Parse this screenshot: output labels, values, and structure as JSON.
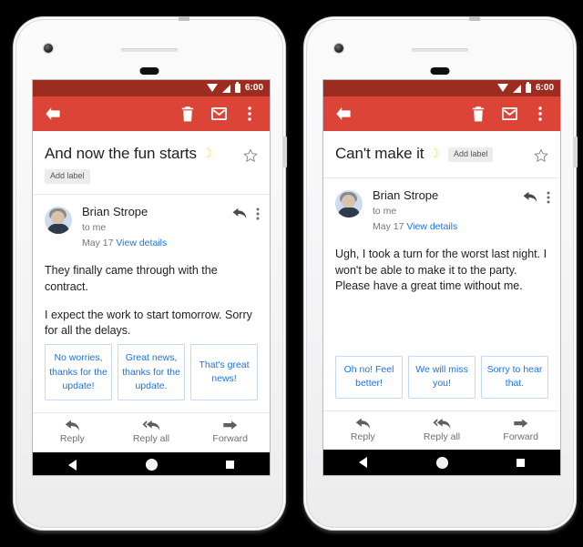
{
  "background_color": "#000000",
  "colors": {
    "status_bar": "#9c2b20",
    "app_bar": "#db4437",
    "link_blue": "#1a73e8",
    "chip_border": "#c3d9f5",
    "text_primary": "#212121",
    "text_secondary": "#757575"
  },
  "status_bar": {
    "time": "6:00",
    "icons": [
      "wifi-icon",
      "signal-icon",
      "battery-icon"
    ]
  },
  "app_bar": {
    "back_icon": "back-arrow-icon",
    "delete_icon": "trash-icon",
    "mark_unread_icon": "envelope-icon",
    "overflow_icon": "overflow-menu-icon"
  },
  "sender": {
    "name": "Brian Strope",
    "recipient": "to me",
    "date": "May 17",
    "view_details": "View details",
    "reply_icon": "reply-arrow-icon",
    "overflow_icon": "overflow-menu-icon",
    "avatar": "contact-avatar"
  },
  "action_bar": {
    "reply": "Reply",
    "reply_all": "Reply all",
    "forward": "Forward"
  },
  "nav_bar": {
    "back": "nav-back-icon",
    "home": "nav-home-icon",
    "recents": "nav-recents-icon"
  },
  "phones": [
    {
      "subject": "And now the fun starts",
      "emoji": "☽",
      "add_label": "Add label",
      "label_placement": "stacked",
      "star_icon": "star-outline-icon",
      "paragraphs": [
        "They finally came through with the contract.",
        "I expect the work to start tomorrow. Sorry for all the delays."
      ],
      "smart_replies": [
        "No worries, thanks for the update!",
        "Great news, thanks for the update.",
        "That's great news!"
      ]
    },
    {
      "subject": "Can't make it",
      "emoji": "☽",
      "add_label": "Add label",
      "label_placement": "inline",
      "star_icon": "star-outline-icon",
      "paragraphs": [
        "Ugh, I took a turn for the worst last night. I won't be able to make it to the party. Please have a great time without me."
      ],
      "smart_replies": [
        "Oh no! Feel better!",
        "We will miss you!",
        "Sorry to hear that."
      ]
    }
  ]
}
